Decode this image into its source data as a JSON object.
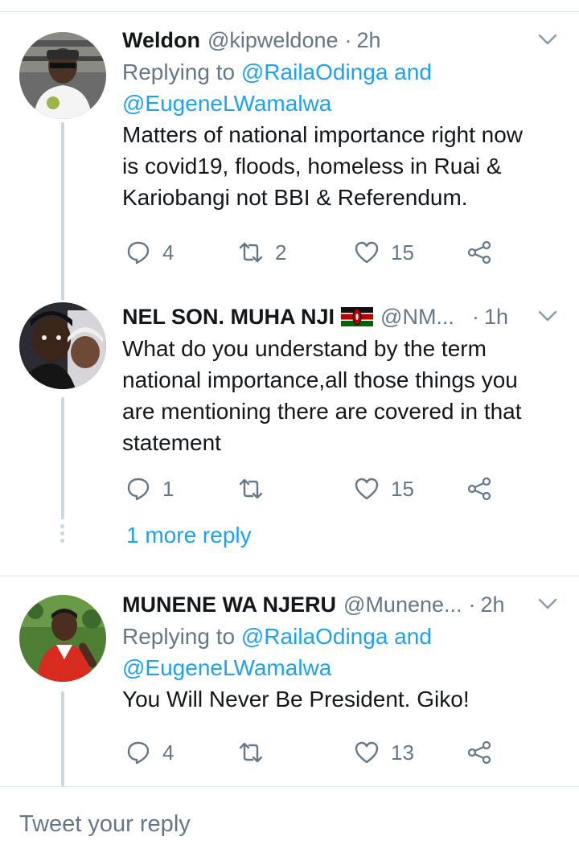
{
  "tweets": [
    {
      "name": "Weldon",
      "handle": "@kipweldone",
      "time": "2h",
      "reply_prefix": "Replying to ",
      "reply_link1": "@RailaOdinga",
      "reply_and": " and",
      "reply_link2": "@EugeneLWamalwa",
      "text_lines": [
        "Matters of national importance right now",
        "is covid19, floods, homeless in Ruai &",
        "Kariobangi not BBI & Referendum."
      ],
      "replies": "4",
      "retweets": "2",
      "likes": "15"
    },
    {
      "name": "NEL SON. MUHA NJI",
      "handle": "@NM...",
      "time": "1h",
      "text_lines": [
        "What do you understand by the term",
        "national importance,all those things you",
        "are mentioning there are covered in that",
        "statement"
      ],
      "replies": "1",
      "retweets": "",
      "likes": "15"
    },
    {
      "name": "MUNENE WA NJERU",
      "handle": "@Munene...",
      "time": "2h",
      "reply_prefix": "Replying to ",
      "reply_link1": "@RailaOdinga",
      "reply_and": " and",
      "reply_link2": "@EugeneLWamalwa",
      "text_lines": [
        "You Will Never Be President. Giko!"
      ],
      "replies": "4",
      "retweets": "",
      "likes": "13"
    }
  ],
  "dot_separator": "·",
  "more_replies": "1 more reply",
  "composer_placeholder": "Tweet your reply",
  "colors": {
    "accent": "#1da1f2",
    "secondary_text": "#657786",
    "divider": "#e1e8ed",
    "thread_line": "#ccd6dd"
  },
  "icons": [
    "reply-icon",
    "retweet-icon",
    "like-icon",
    "share-icon",
    "chevron-down-icon",
    "kenya-flag-icon"
  ]
}
